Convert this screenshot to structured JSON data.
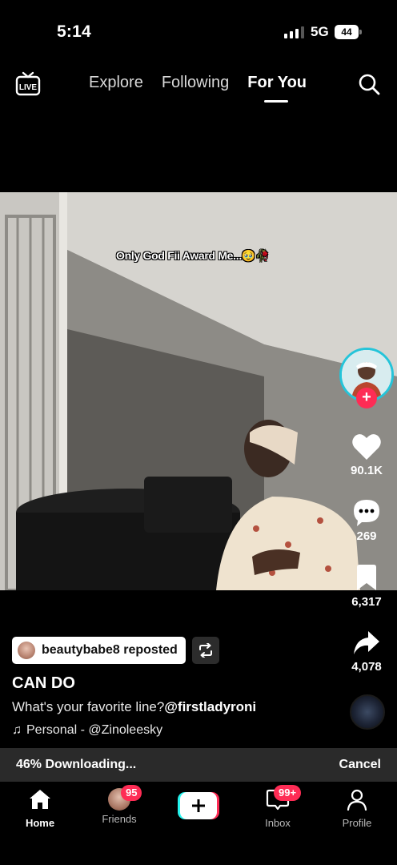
{
  "status_bar": {
    "time": "5:14",
    "network": "5G",
    "battery": "44"
  },
  "top_nav": {
    "live_label": "LIVE",
    "tabs": [
      {
        "label": "Explore",
        "active": false
      },
      {
        "label": "Following",
        "active": false
      },
      {
        "label": "For You",
        "active": true
      }
    ]
  },
  "video": {
    "overlay_caption": "Only God Fii Award Me...🥹🥀"
  },
  "actions": {
    "likes": "90.1K",
    "comments": "269",
    "saves": "6,317",
    "shares": "4,078"
  },
  "post": {
    "repost_label": "beautybabe8 reposted",
    "title": "CAN DO",
    "description": "What's your favorite line?",
    "mention": "@firstladyroni",
    "music": "Personal - @Zinoleesky"
  },
  "download": {
    "status": "46% Downloading...",
    "cancel_label": "Cancel"
  },
  "tabbar": {
    "home": "Home",
    "friends": "Friends",
    "friends_badge": "95",
    "inbox": "Inbox",
    "inbox_badge": "99+",
    "profile": "Profile"
  },
  "colors": {
    "accent_red": "#fe2c55",
    "accent_cyan": "#25f4ee",
    "background": "#000000"
  }
}
